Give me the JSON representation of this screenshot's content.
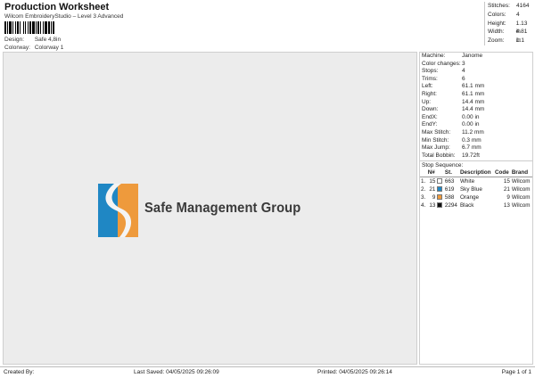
{
  "header": {
    "title": "Production Worksheet",
    "subtitle": "Wilcom EmbroideryStudio – Level 3 Advanced",
    "design_label": "Design:",
    "design_value": "Safe 4,8in",
    "colorway_label": "Colorway:",
    "colorway_value": "Colorway 1"
  },
  "top_stats": [
    {
      "k": "Stitches:",
      "v": "4164"
    },
    {
      "k": "Colors:",
      "v": "4"
    },
    {
      "k": "Height:",
      "v": "1.13 in"
    },
    {
      "k": "Width:",
      "v": "4.81 in"
    },
    {
      "k": "Zoom:",
      "v": "1:1"
    }
  ],
  "design": {
    "logo_text": "Safe Management Group",
    "colors": {
      "blue": "#1f87c4",
      "orange": "#ee9a3c",
      "white": "#f4f4f4",
      "text": "#3a3a3a"
    }
  },
  "machine": [
    {
      "k": "Machine:",
      "v": "Janome"
    },
    {
      "k": "Color changes:",
      "v": "3"
    },
    {
      "k": "Stops:",
      "v": "4"
    },
    {
      "k": "Trims:",
      "v": "6"
    },
    {
      "k": "Left:",
      "v": "61.1 mm"
    },
    {
      "k": "Right:",
      "v": "61.1 mm"
    },
    {
      "k": "Up:",
      "v": "14.4 mm"
    },
    {
      "k": "Down:",
      "v": "14.4 mm"
    },
    {
      "k": "EndX:",
      "v": "0.00 in"
    },
    {
      "k": "EndY:",
      "v": "0.00 in"
    },
    {
      "k": "Max Stitch:",
      "v": "11.2 mm"
    },
    {
      "k": "Min Stitch:",
      "v": "0.3 mm"
    },
    {
      "k": "Max Jump:",
      "v": "6.7 mm"
    },
    {
      "k": "Total Bobbin:",
      "v": "19.72ft"
    }
  ],
  "stop_sequence": {
    "heading": "Stop Sequence:",
    "columns": [
      "",
      "N#",
      "",
      "St.",
      "Description",
      "Code",
      "Brand"
    ],
    "rows": [
      {
        "idx": "1.",
        "n": "15",
        "color": "#ffffff",
        "st": "663",
        "desc": "White",
        "code": "15",
        "brand": "Wilcom"
      },
      {
        "idx": "2.",
        "n": "21",
        "color": "#1f87c4",
        "st": "619",
        "desc": "Sky Blue",
        "code": "21",
        "brand": "Wilcom"
      },
      {
        "idx": "3.",
        "n": "9",
        "color": "#ee9a3c",
        "st": "588",
        "desc": "Orange",
        "code": "9",
        "brand": "Wilcom"
      },
      {
        "idx": "4.",
        "n": "13",
        "color": "#111111",
        "st": "2294",
        "desc": "Black",
        "code": "13",
        "brand": "Wilcom"
      }
    ]
  },
  "footer": {
    "created_by": "Created By:",
    "last_saved": "Last Saved: 04/05/2025 09:26:09",
    "printed": "Printed: 04/05/2025 09:26:14",
    "page": "Page 1 of 1"
  }
}
